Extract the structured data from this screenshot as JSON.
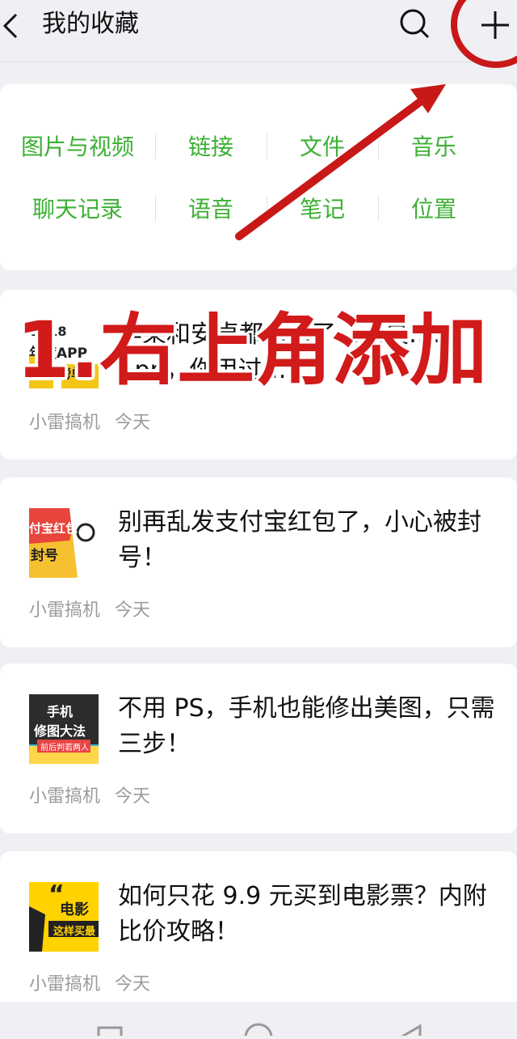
{
  "header": {
    "title": "我的收藏",
    "icons": [
      "back-icon",
      "search-icon",
      "plus-icon"
    ]
  },
  "categories": {
    "row1": [
      "图片与视频",
      "链接",
      "文件",
      "音乐"
    ],
    "row2": [
      "聊天记录",
      "语音",
      "笔记",
      "位置"
    ]
  },
  "items": [
    {
      "title": "苹果和安卓都……了……最……App，你用过……",
      "source": "小雷搞机",
      "date": "今天",
      "thumb_text": [
        "2018",
        "年度APP",
        "榜单"
      ]
    },
    {
      "title": "别再乱发支付宝红包了，小心被封号！",
      "source": "小雷搞机",
      "date": "今天",
      "thumb_text": [
        "付宝红包",
        "封号"
      ]
    },
    {
      "title": "不用 PS，手机也能修出美图，只需三步！",
      "source": "小雷搞机",
      "date": "今天",
      "thumb_text": [
        "手机",
        "修图大法",
        "前后判若两人"
      ]
    },
    {
      "title": "如何只花 9.9 元买到电影票？内附比价攻略！",
      "source": "小雷搞机",
      "date": "今天",
      "thumb_text": [
        "“",
        "电影",
        "这样买最"
      ]
    }
  ],
  "annotation": {
    "text": "1.右上角添加",
    "color": "#d11a1a"
  },
  "colors": {
    "category_green": "#3cb034",
    "meta_gray": "#9b9b9b",
    "background": "#efeff4"
  }
}
